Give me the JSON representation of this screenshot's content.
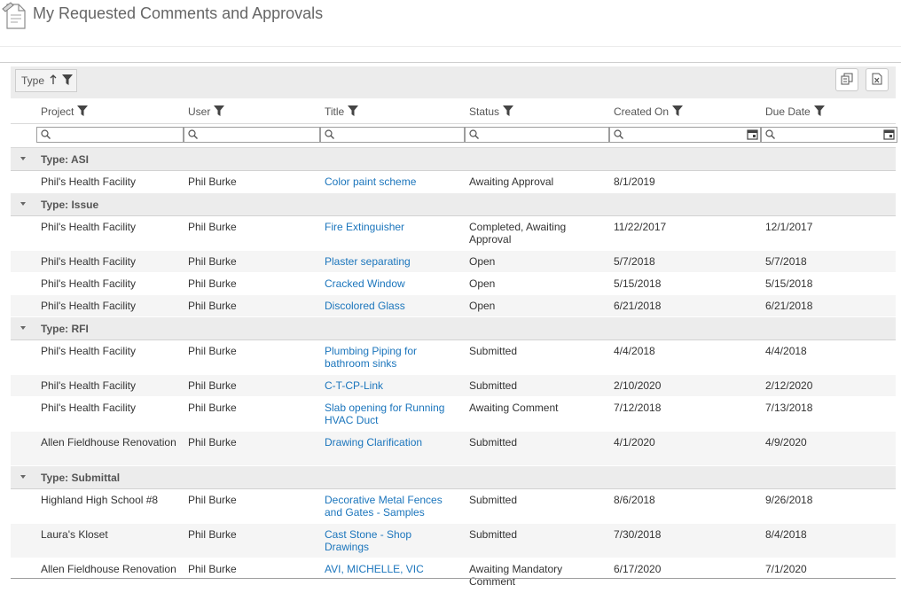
{
  "page": {
    "title": "My Requested Comments and Approvals"
  },
  "toolbar": {
    "group_chip_label": "Type",
    "icons": [
      "sort-ascending-icon",
      "filter-icon",
      "column-chooser-icon",
      "excel-export-icon"
    ]
  },
  "columns": [
    {
      "key": "project",
      "label": "Project"
    },
    {
      "key": "user",
      "label": "User"
    },
    {
      "key": "title",
      "label": "Title"
    },
    {
      "key": "status",
      "label": "Status"
    },
    {
      "key": "created_on",
      "label": "Created On"
    },
    {
      "key": "due_date",
      "label": "Due Date"
    }
  ],
  "filters": {
    "project": "",
    "user": "",
    "title": "",
    "status": "",
    "created_on": "",
    "due_date": ""
  },
  "colors": {
    "link": "#1b75bc",
    "group_bg": "#ececec",
    "alt_row_bg": "#f5f5f5"
  },
  "groups": [
    {
      "label": "Type: ASI",
      "rows": [
        {
          "project": "Phil's Health Facility",
          "user": "Phil Burke",
          "title": "Color paint scheme",
          "status": "Awaiting Approval",
          "created_on": "8/1/2019",
          "due_date": ""
        }
      ]
    },
    {
      "label": "Type: Issue",
      "rows": [
        {
          "project": "Phil's Health Facility",
          "user": "Phil Burke",
          "title": "Fire Extinguisher",
          "status": "Completed, Awaiting Approval",
          "created_on": "11/22/2017",
          "due_date": "12/1/2017"
        },
        {
          "project": "Phil's Health Facility",
          "user": "Phil Burke",
          "title": "Plaster separating",
          "status": "Open",
          "created_on": "5/7/2018",
          "due_date": "5/7/2018"
        },
        {
          "project": "Phil's Health Facility",
          "user": "Phil Burke",
          "title": "Cracked Window",
          "status": "Open",
          "created_on": "5/15/2018",
          "due_date": "5/15/2018"
        },
        {
          "project": "Phil's Health Facility",
          "user": "Phil Burke",
          "title": "Discolored Glass",
          "status": "Open",
          "created_on": "6/21/2018",
          "due_date": "6/21/2018"
        }
      ]
    },
    {
      "label": "Type: RFI",
      "rows": [
        {
          "project": "Phil's Health Facility",
          "user": "Phil Burke",
          "title": "Plumbing Piping for bathroom sinks",
          "status": "Submitted",
          "created_on": "4/4/2018",
          "due_date": "4/4/2018"
        },
        {
          "project": "Phil's Health Facility",
          "user": "Phil Burke",
          "title": "C-T-CP-Link",
          "status": "Submitted",
          "created_on": "2/10/2020",
          "due_date": "2/12/2020"
        },
        {
          "project": "Phil's Health Facility",
          "user": "Phil Burke",
          "title": "Slab opening for Running HVAC Duct",
          "status": "Awaiting Comment",
          "created_on": "7/12/2018",
          "due_date": "7/13/2018"
        },
        {
          "project": "Allen Fieldhouse Renovation",
          "user": "Phil Burke",
          "title": "Drawing Clarification",
          "status": "Submitted",
          "created_on": "4/1/2020",
          "due_date": "4/9/2020"
        }
      ]
    },
    {
      "label": "Type: Submittal",
      "rows": [
        {
          "project": "Highland High School #8",
          "user": "Phil Burke",
          "title": "Decorative Metal Fences and Gates - Samples",
          "status": "Submitted",
          "created_on": "8/6/2018",
          "due_date": "9/26/2018"
        },
        {
          "project": "Laura's Kloset",
          "user": "Phil Burke",
          "title": "Cast Stone - Shop Drawings",
          "status": "Submitted",
          "created_on": "7/30/2018",
          "due_date": "8/4/2018"
        },
        {
          "project": "Allen Fieldhouse Renovation",
          "user": "Phil Burke",
          "title": "AVI, MICHELLE, VIC",
          "status": "Awaiting Mandatory Comment",
          "created_on": "6/17/2020",
          "due_date": "7/1/2020"
        }
      ]
    }
  ]
}
